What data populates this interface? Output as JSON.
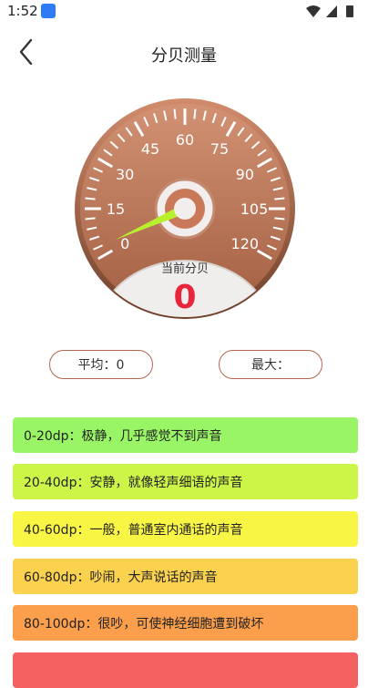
{
  "status_bar": {
    "time": "1:52"
  },
  "header": {
    "title": "分贝测量"
  },
  "gauge": {
    "ticks": [
      "0",
      "15",
      "30",
      "45",
      "60",
      "75",
      "90",
      "105",
      "120"
    ],
    "current_label": "当前分贝",
    "current_value": "0",
    "min": 0,
    "max": 120,
    "needle_value": 3
  },
  "stats": {
    "average": "平均：0",
    "max": "最大："
  },
  "levels": [
    {
      "text": "0-20dp：极静，几乎感觉不到声音",
      "color": "#99f566"
    },
    {
      "text": "20-40dp：安静，就像轻声细语的声音",
      "color": "#cdf548"
    },
    {
      "text": "40-60dp：一般，普通室内通话的声音",
      "color": "#f9f545"
    },
    {
      "text": "60-80dp：吵闹，大声说话的声音",
      "color": "#fbd24e"
    },
    {
      "text": "80-100dp：很吵，可使神经细胞遭到破坏",
      "color": "#fb9f4c"
    },
    {
      "text": "",
      "color": "#f56060"
    }
  ],
  "colors": {
    "dial_outer": "#7d4a33",
    "dial_inner": "#c27756",
    "needle": "#b7f12e",
    "value": "#e8253b"
  }
}
